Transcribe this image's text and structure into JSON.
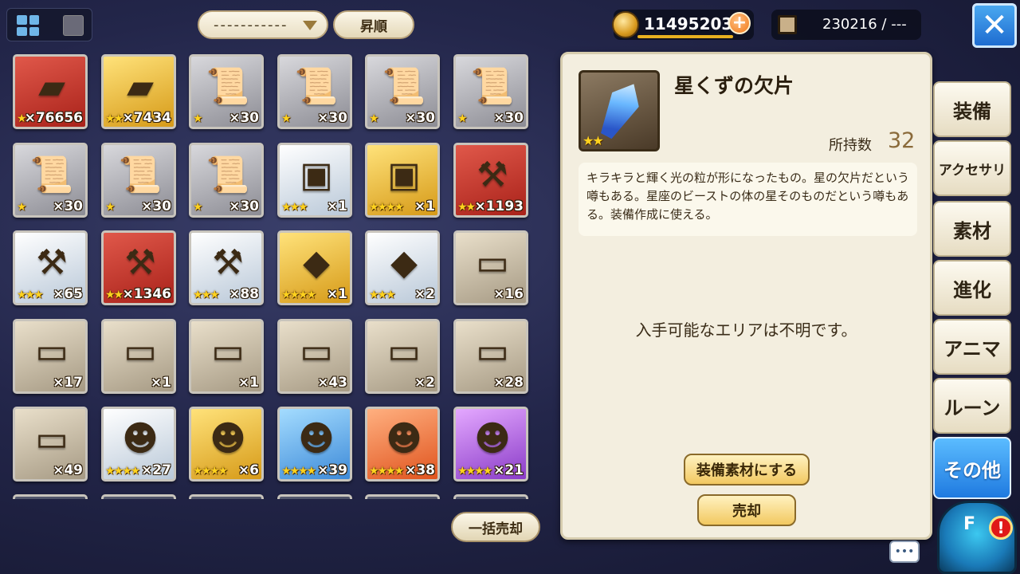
{
  "toolbar": {
    "filter_value": "-----------",
    "sort_label": "昇順"
  },
  "currency": {
    "gold": "11495203",
    "plus": "+",
    "capacity": "230216 / ---"
  },
  "close_label": "✕",
  "items": [
    {
      "icon": "gold-bar-icon",
      "glyph": "▰",
      "rarity": "r-red",
      "stars": "★",
      "qty": "×76656"
    },
    {
      "icon": "gold-bars-icon",
      "glyph": "▰",
      "rarity": "r-gold",
      "stars": "★★",
      "qty": "×7434"
    },
    {
      "icon": "blueprint-icon",
      "glyph": "📜",
      "rarity": "r-grey",
      "stars": "★",
      "qty": "×30"
    },
    {
      "icon": "blueprint-icon",
      "glyph": "📜",
      "rarity": "r-grey",
      "stars": "★",
      "qty": "×30"
    },
    {
      "icon": "blueprint-icon",
      "glyph": "📜",
      "rarity": "r-grey",
      "stars": "★",
      "qty": "×30"
    },
    {
      "icon": "blueprint-icon",
      "glyph": "📜",
      "rarity": "r-grey",
      "stars": "★",
      "qty": "×30"
    },
    {
      "icon": "blueprint-icon",
      "glyph": "📜",
      "rarity": "r-grey",
      "stars": "★",
      "qty": "×30"
    },
    {
      "icon": "blueprint-icon",
      "glyph": "📜",
      "rarity": "r-grey",
      "stars": "★",
      "qty": "×30"
    },
    {
      "icon": "blueprint-icon",
      "glyph": "📜",
      "rarity": "r-grey",
      "stars": "★",
      "qty": "×30"
    },
    {
      "icon": "silver-chest-icon",
      "glyph": "▣",
      "rarity": "r-white",
      "stars": "★★★",
      "qty": "×1"
    },
    {
      "icon": "gold-chest-icon",
      "glyph": "▣",
      "rarity": "r-gold",
      "stars": "★★★★",
      "qty": "×1"
    },
    {
      "icon": "hammer-icon",
      "glyph": "⚒",
      "rarity": "r-red",
      "stars": "★★",
      "qty": "×1193"
    },
    {
      "icon": "hammer-icon",
      "glyph": "⚒",
      "rarity": "r-white",
      "stars": "★★★",
      "qty": "×65"
    },
    {
      "icon": "hammer-icon",
      "glyph": "⚒",
      "rarity": "r-red",
      "stars": "★★",
      "qty": "×1346"
    },
    {
      "icon": "hammer-icon",
      "glyph": "⚒",
      "rarity": "r-white",
      "stars": "★★★",
      "qty": "×88"
    },
    {
      "icon": "red-crystal-icon",
      "glyph": "◆",
      "rarity": "r-gold",
      "stars": "★★★★",
      "qty": "×1"
    },
    {
      "icon": "red-crystal-icon",
      "glyph": "◆",
      "rarity": "r-white",
      "stars": "★★★",
      "qty": "×2"
    },
    {
      "icon": "ticket-icon",
      "glyph": "▭",
      "rarity": "r-beige",
      "stars": "",
      "qty": "×16"
    },
    {
      "icon": "ticket-icon",
      "glyph": "▭",
      "rarity": "r-beige",
      "stars": "",
      "qty": "×17"
    },
    {
      "icon": "ticket-icon",
      "glyph": "▭",
      "rarity": "r-beige",
      "stars": "",
      "qty": "×1"
    },
    {
      "icon": "ticket-icon",
      "glyph": "▭",
      "rarity": "r-beige",
      "stars": "",
      "qty": "×1"
    },
    {
      "icon": "ticket-icon",
      "glyph": "▭",
      "rarity": "r-beige",
      "stars": "",
      "qty": "×43"
    },
    {
      "icon": "ticket-icon",
      "glyph": "▭",
      "rarity": "r-beige",
      "stars": "",
      "qty": "×2"
    },
    {
      "icon": "ticket-icon",
      "glyph": "▭",
      "rarity": "r-beige",
      "stars": "",
      "qty": "×28"
    },
    {
      "icon": "ticket-icon",
      "glyph": "▭",
      "rarity": "r-beige",
      "stars": "",
      "qty": "×49"
    },
    {
      "icon": "creature-head-icon",
      "glyph": "☻",
      "rarity": "r-white",
      "stars": "★★★★",
      "qty": "×27"
    },
    {
      "icon": "creature-head-icon",
      "glyph": "☻",
      "rarity": "r-gold",
      "stars": "★★★★",
      "qty": "×6"
    },
    {
      "icon": "creature-head-icon",
      "glyph": "☻",
      "rarity": "r-blue",
      "stars": "★★★★",
      "qty": "×39"
    },
    {
      "icon": "creature-head-icon",
      "glyph": "☻",
      "rarity": "r-orange",
      "stars": "★★★★",
      "qty": "×38"
    },
    {
      "icon": "creature-head-icon",
      "glyph": "☻",
      "rarity": "r-purple",
      "stars": "★★★★",
      "qty": "×21"
    }
  ],
  "bulk_sell_label": "一括売却",
  "detail": {
    "name": "星くずの欠片",
    "stars": "★★",
    "owned_label": "所持数",
    "owned_value": "32",
    "description": "キラキラと輝く光の粒が形になったもの。星の欠片だという噂もある。星座のビーストの体の星そのものだという噂もある。装備作成に使える。",
    "area_text": "入手可能なエリアは不明です。",
    "equip_material_label": "装備素材にする",
    "sell_label": "売却"
  },
  "categories": [
    {
      "label": "装備",
      "active": false
    },
    {
      "label": "アクセサリ",
      "active": false
    },
    {
      "label": "素材",
      "active": false
    },
    {
      "label": "進化",
      "active": false
    },
    {
      "label": "アニマ",
      "active": false
    },
    {
      "label": "ルーン",
      "active": false
    },
    {
      "label": "その他",
      "active": true
    }
  ],
  "mascot": {
    "label": "F",
    "alert": "!"
  },
  "chat_label": "•••"
}
